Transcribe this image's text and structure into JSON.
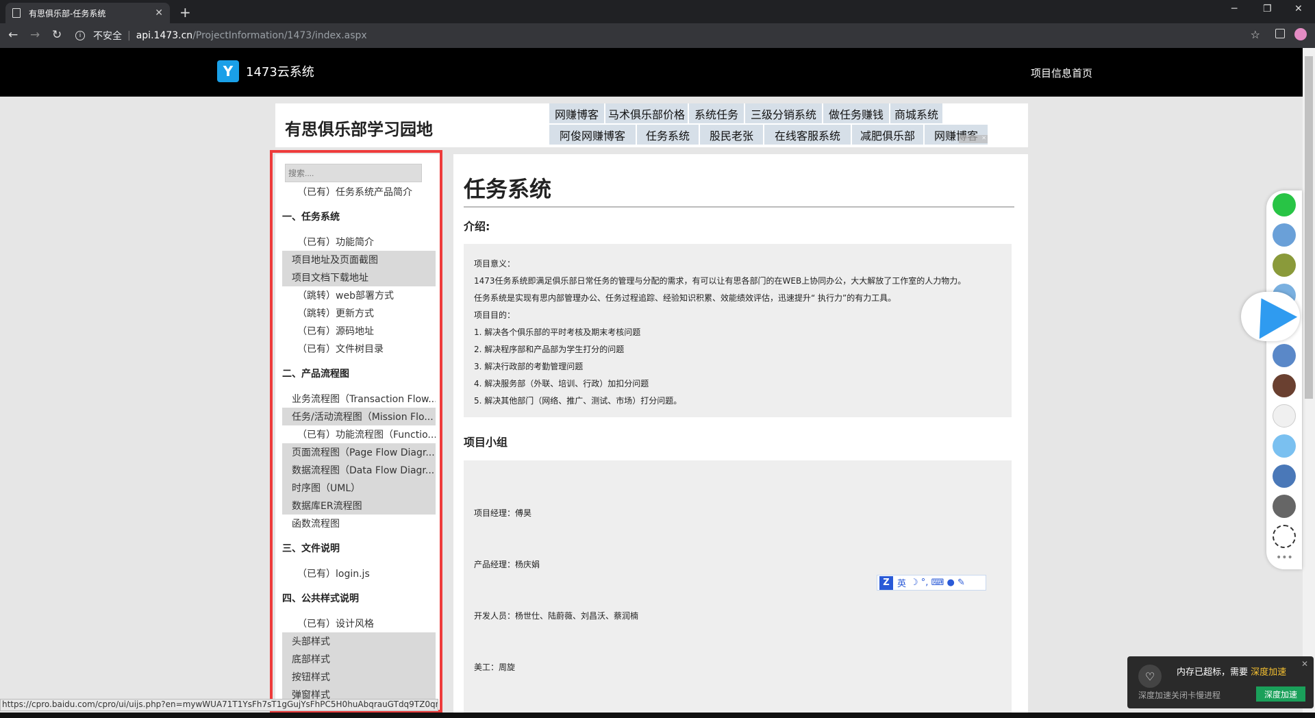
{
  "browser": {
    "tab_title": "有思俱乐部-任务系统",
    "tab_close": "✕",
    "new_tab": "+",
    "win_min": "─",
    "win_max": "❐",
    "win_close": "✕",
    "security_label": "不安全",
    "url_host": "api.1473.cn",
    "url_path": "/ProjectInformation/1473/index.aspx",
    "status_url": "https://cpro.baidu.com/cpro/ui/uijs.php?en=mywWUA71T1YsFh7sT1gGujYsFhPC5H0huAbqrauGTdq9TZ0qn..."
  },
  "header": {
    "brand_logo_glyph": "Y",
    "brand_name": "1473云系统",
    "home_link": "项目信息首页"
  },
  "banner": {
    "title": "有思俱乐部学习园地",
    "row1": [
      "网赚博客",
      "马术俱乐部价格",
      "系统任务",
      "三级分销系统",
      "做任务赚钱",
      "商城系统"
    ],
    "row2": [
      "阿俊网赚博客",
      "任务系统",
      "股民老张",
      "在线客服系统",
      "减肥俱乐部",
      "网赚博客"
    ]
  },
  "sidebar": {
    "search_placeholder": "搜索....",
    "items": [
      "（已有）任务系统产品简介",
      "一、任务系统",
      "（已有）功能简介",
      "项目地址及页面截图",
      "项目文档下载地址",
      "（跳转）web部署方式",
      "（跳转）更新方式",
      "（已有）源码地址",
      "（已有）文件树目录",
      "二、产品流程图",
      "业务流程图（Transaction Flow...",
      "任务/活动流程图（Mission Flo...",
      "（已有）功能流程图（Functio...",
      "页面流程图（Page Flow Diagr...",
      "数据流程图（Data Flow Diagr...",
      "时序图（UML）",
      "数据库ER流程图",
      "函数流程图",
      "三、文件说明",
      "（已有）login.js",
      "四、公共样式说明",
      "（已有）设计风格",
      "头部样式",
      "底部样式",
      "按钮样式",
      "弹窗样式"
    ]
  },
  "content": {
    "title": "任务系统",
    "intro_title": "介绍:",
    "intro_lines": [
      "项目意义：",
      "1473任务系统即满足俱乐部日常任务的管理与分配的需求，有可以让有思各部门的在WEB上协同办公，大大解放了工作室的人力物力。",
      "任务系统是实现有思内部管理办公、任务过程追踪、经验知识积累、效能绩效评估，迅速提升“ 执行力”的有力工具。",
      "项目目的：",
      "1. 解决各个俱乐部的平时考核及期末考核问题",
      "2. 解决程序部和产品部为学生打分的问题",
      "3. 解决行政部的考勤管理问题",
      "4. 解决服务部（外联、培训、行政）加扣分问题",
      "5. 解决其他部门（网络、推广、测试、市场）打分问题。"
    ],
    "team_title": "项目小组",
    "team_lines": [
      "项目经理：傅昊",
      "产品经理：杨庆娟",
      "开发人员：杨世仕、陆蔚薇、刘昌沃、蔡润楠",
      "美工：周旋"
    ]
  },
  "ime": {
    "logo": "Z",
    "lang": "英",
    "icons": "☽ °, ⌨ ● ✎"
  },
  "notification": {
    "message": "内存已超标，需要",
    "highlight": "深度加速",
    "sub": "深度加速关闭卡慢进程",
    "button": "深度加速",
    "close": "✕"
  },
  "colors": {
    "highlight_border": "#ee3b3b",
    "brand_blue": "#1aa0e8",
    "sidebar_gray": "#d9d9d9",
    "ad_link_bg": "#d6dfe8"
  }
}
